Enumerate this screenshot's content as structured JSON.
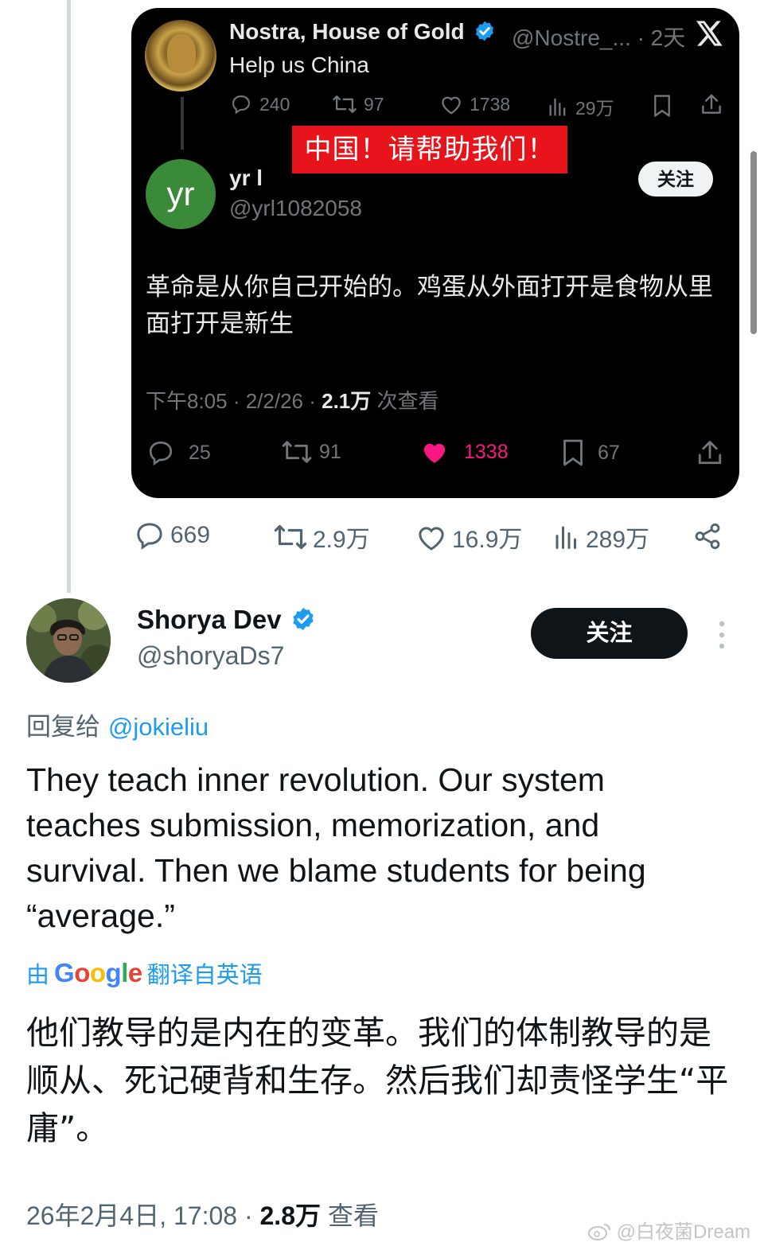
{
  "quoted": {
    "author_name": "Nostra, House of Gold",
    "handle_time": "@Nostre_... · 2天",
    "text": "Help us China",
    "stats": {
      "replies": "240",
      "reposts": "97",
      "likes": "1738",
      "views": "29万"
    },
    "overlay_caption": "中国！请帮助我们！"
  },
  "reply_card": {
    "avatar_text": "yr",
    "name": "yr l",
    "handle": "@yrl1082058",
    "follow_label": "关注",
    "text": "革命是从你自己开始的。鸡蛋从外面打开是食物从里面打开是新生",
    "meta_time": "下午8:05 · 2/2/26 · ",
    "meta_views_count": "2.1万",
    "meta_views_label": " 次查看",
    "stats": {
      "replies": "25",
      "reposts": "91",
      "likes": "1338",
      "bookmarks": "67"
    },
    "like_color": "#f91880"
  },
  "outer_stats": {
    "replies": "669",
    "reposts": "2.9万",
    "likes": "16.9万",
    "views": "289万"
  },
  "main": {
    "name": "Shorya Dev",
    "handle": "@shoryaDs7",
    "follow_label": "关注",
    "reply_prefix": "回复给 ",
    "reply_mention": "@jokieliu",
    "text": "They teach inner revolution. Our system teaches submission, memorization, and survival. Then we blame students for being “average.”",
    "translate_prefix": "由",
    "translate_suffix": "翻译自英语",
    "translation": "他们教导的是内在的变革。我们的体制教导的是顺从、死记硬背和生存。然后我们却责怪学生“平庸”。",
    "meta_time": "26年2月4日, 17:08 · ",
    "meta_views_count": "2.8万",
    "meta_views_label": " 查看"
  },
  "watermark": "@白夜菌Dream",
  "colors": {
    "accent": "#1d9bf0",
    "verified": "#1d9bf0",
    "like_pink": "#f91880",
    "banner_red": "#e8141b"
  }
}
